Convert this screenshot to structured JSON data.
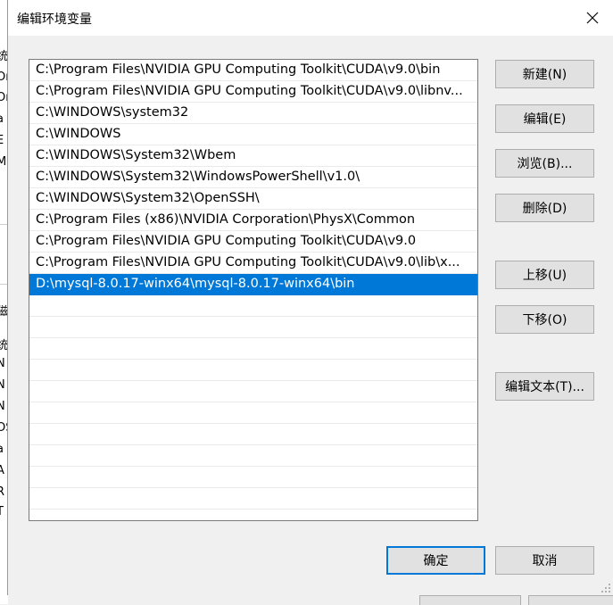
{
  "window": {
    "title": "编辑环境变量"
  },
  "paths": [
    "C:\\Program Files\\NVIDIA GPU Computing Toolkit\\CUDA\\v9.0\\bin",
    "C:\\Program Files\\NVIDIA GPU Computing Toolkit\\CUDA\\v9.0\\libnv...",
    "C:\\WINDOWS\\system32",
    "C:\\WINDOWS",
    "C:\\WINDOWS\\System32\\Wbem",
    "C:\\WINDOWS\\System32\\WindowsPowerShell\\v1.0\\",
    "C:\\WINDOWS\\System32\\OpenSSH\\",
    "C:\\Program Files (x86)\\NVIDIA Corporation\\PhysX\\Common",
    "C:\\Program Files\\NVIDIA GPU Computing Toolkit\\CUDA\\v9.0",
    "C:\\Program Files\\NVIDIA GPU Computing Toolkit\\CUDA\\v9.0\\lib\\x...",
    "D:\\mysql-8.0.17-winx64\\mysql-8.0.17-winx64\\bin"
  ],
  "selected_index": 10,
  "buttons": {
    "new": "新建(N)",
    "edit": "编辑(E)",
    "browse": "浏览(B)...",
    "delete": "删除(D)",
    "move_up": "上移(U)",
    "move_down": "下移(O)",
    "edit_text": "编辑文本(T)...",
    "ok": "确定",
    "cancel": "取消"
  },
  "background_fragments": [
    "统",
    "Or",
    "Or",
    "a",
    "E",
    "M",
    "磁",
    "统",
    "N",
    "N",
    "N",
    "OS",
    "a",
    "A",
    "R",
    "T"
  ],
  "colors": {
    "selection": "#0078d7",
    "dialog_bg": "#f0f0f0",
    "button_bg": "#e1e1e1"
  }
}
